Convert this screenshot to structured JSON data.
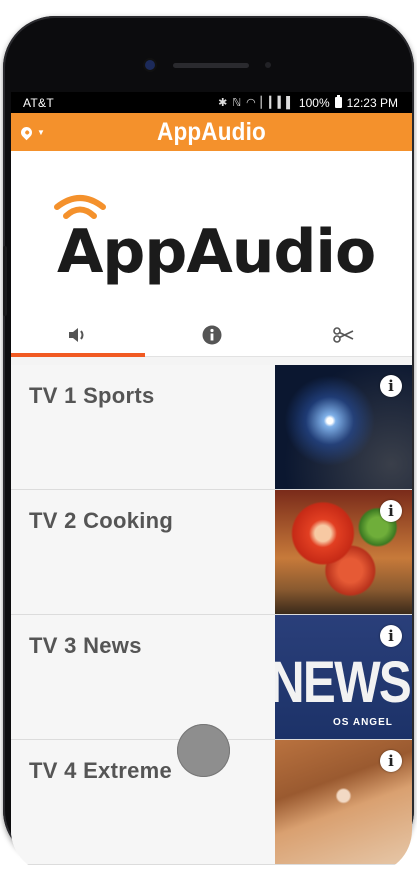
{
  "status_bar": {
    "carrier": "AT&T",
    "battery": "100%",
    "time": "12:23 PM"
  },
  "app_bar": {
    "title": "AppAudio"
  },
  "logo": {
    "text": "AppAudio",
    "wave_color": "#f4912c"
  },
  "tabs": [
    {
      "icon": "speaker-icon",
      "active": true
    },
    {
      "icon": "info-icon",
      "active": false
    },
    {
      "icon": "scissors-icon",
      "active": false
    }
  ],
  "channels": [
    {
      "name": "TV 1 Sports",
      "image": "sports-thumbnail"
    },
    {
      "name": "TV 2 Cooking",
      "image": "cooking-thumbnail"
    },
    {
      "name": "TV 3 News",
      "image": "news-thumbnail",
      "image_text": "NEWS",
      "image_subtext": "OS ANGEL"
    },
    {
      "name": "TV 4 Extreme",
      "image": "extreme-thumbnail"
    }
  ],
  "colors": {
    "accent": "#f4912c",
    "tab_indicator": "#f15a22",
    "status_bar": "#000000"
  }
}
